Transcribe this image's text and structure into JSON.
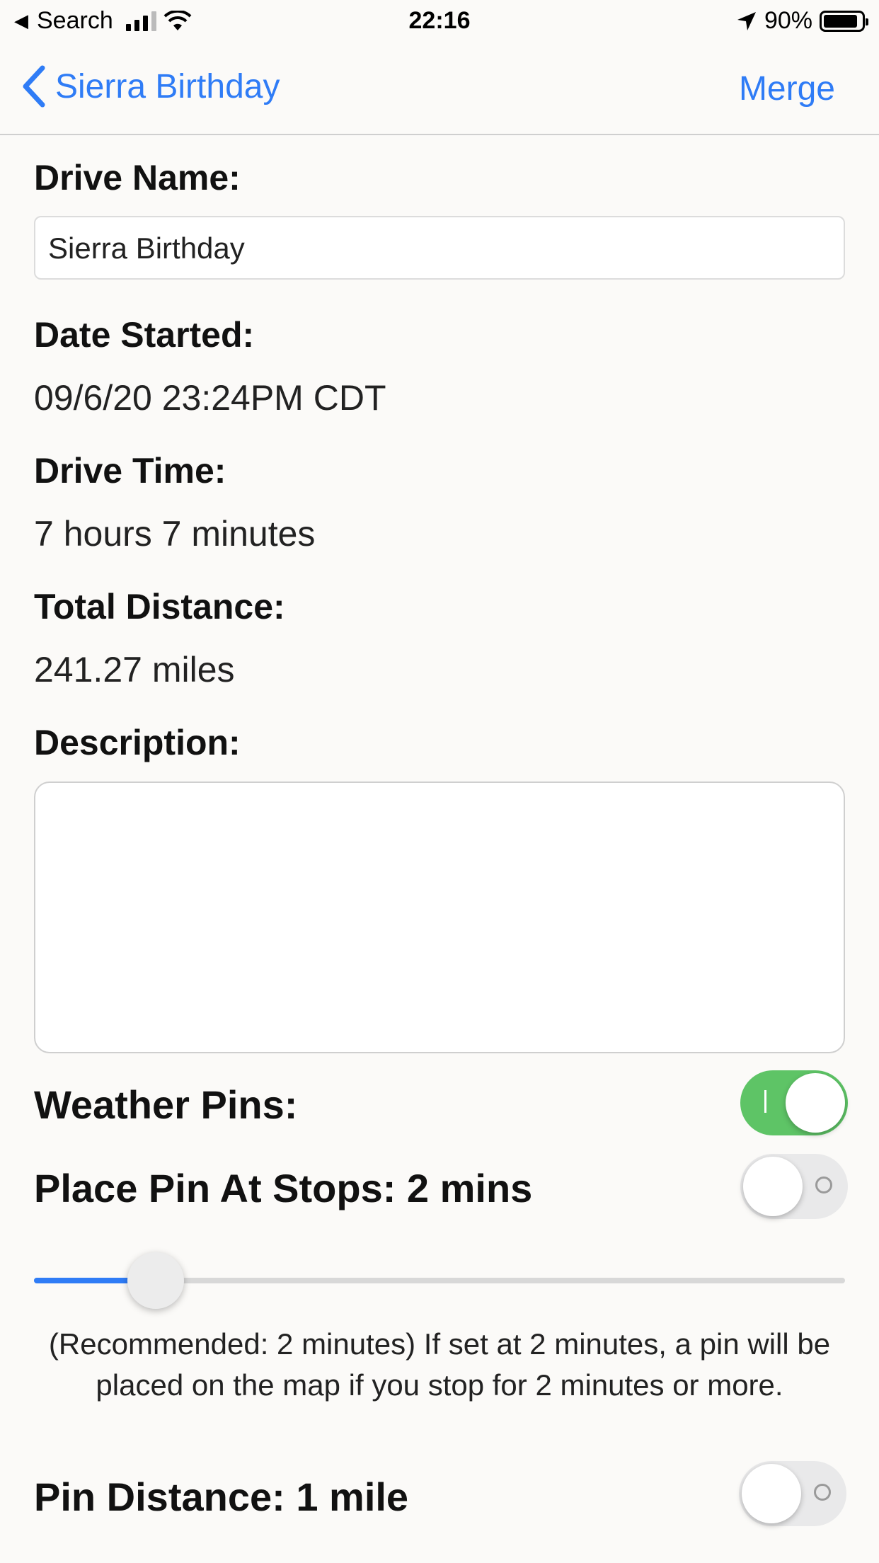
{
  "status_bar": {
    "back_app": "Search",
    "time": "22:16",
    "battery_percent": "90%",
    "battery_level": 0.9
  },
  "nav": {
    "back_label": "Sierra Birthday",
    "action_label": "Merge"
  },
  "form": {
    "drive_name_label": "Drive Name:",
    "drive_name_value": "Sierra Birthday",
    "date_started_label": "Date Started:",
    "date_started_value": "09/6/20 23:24PM CDT",
    "drive_time_label": "Drive Time:",
    "drive_time_value": "7 hours 7 minutes",
    "total_distance_label": "Total Distance:",
    "total_distance_value": "241.27 miles",
    "description_label": "Description:",
    "description_value": ""
  },
  "settings": {
    "weather_pins_label": "Weather Pins:",
    "weather_pins_on": true,
    "place_pin_label": "Place Pin At Stops: 2 mins",
    "place_pin_on": false,
    "stop_slider_fraction": 0.15,
    "recommendation_note": "(Recommended: 2 minutes) If set at 2 minutes, a pin will be placed on the map if you stop for 2 minutes or more.",
    "pin_distance_label": "Pin Distance: 1 mile",
    "pin_distance_on": false
  },
  "colors": {
    "accent": "#2f7cf6",
    "toggle_on": "#5ec466",
    "background": "#fbfaf8"
  }
}
